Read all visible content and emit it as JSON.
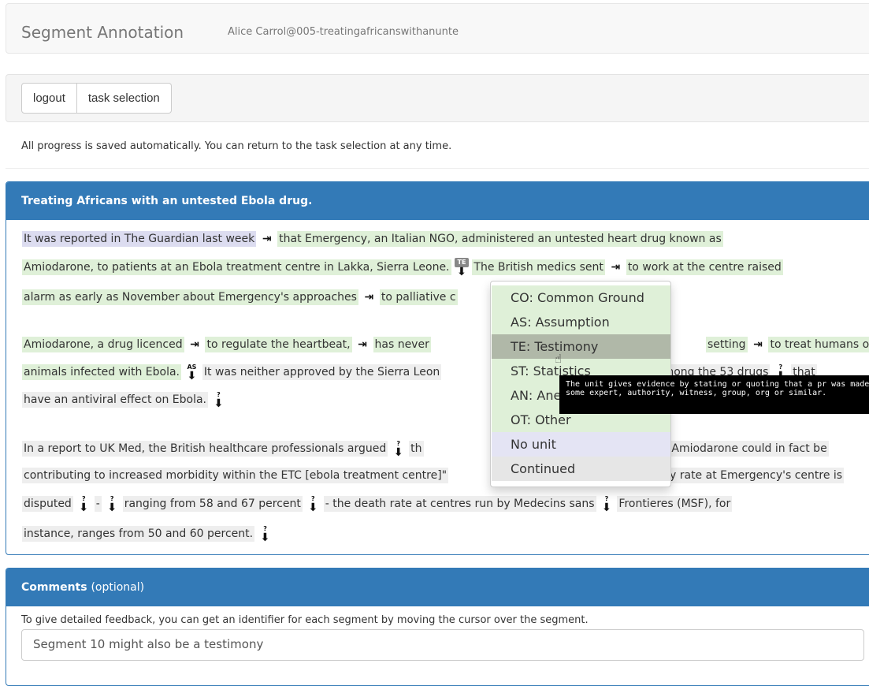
{
  "navbar": {
    "brand": "Segment Annotation",
    "user": "Alice Carrol@005-treatingafricanswithanunte"
  },
  "toolbar": {
    "logout_label": "logout",
    "task_selection_label": "task selection"
  },
  "info_text": "All progress is saved automatically. You can return to the task selection at any time.",
  "article": {
    "title": "Treating Africans with an untested Ebola drug.",
    "lines": [
      [
        {
          "text": "It was reported in The Guardian last week",
          "bg": "purple"
        },
        {
          "marker": "→",
          "tag": ""
        },
        {
          "text": "that Emergency, an Italian NGO, administered an untested heart drug known as",
          "bg": "green"
        }
      ],
      [
        {
          "text": "Amiodarone, to patients at an Ebola treatment centre in Lakka, Sierra Leone.",
          "bg": "green"
        },
        {
          "marker": "↓",
          "tag": "TE",
          "active": true
        },
        {
          "text": "The British medics sent",
          "bg": "green"
        },
        {
          "marker": "→",
          "tag": ""
        },
        {
          "text": "to work at the centre raised",
          "bg": "green"
        }
      ],
      [
        {
          "text": "alarm as early as November about Emergency's approaches",
          "bg": "green"
        },
        {
          "marker": "→",
          "tag": ""
        },
        {
          "text": "to palliative c",
          "bg": "green"
        }
      ],
      [
        {
          "text": "Amiodarone, a drug licenced",
          "bg": "green"
        },
        {
          "marker": "→",
          "tag": ""
        },
        {
          "text": "to regulate the heartbeat,",
          "bg": "green"
        },
        {
          "marker": "→",
          "tag": ""
        },
        {
          "text": "has never",
          "bg": "green"
        }
      ],
      [
        {
          "text": "animals infected with Ebola.",
          "bg": "green"
        },
        {
          "marker": "↓",
          "tag": "AS"
        },
        {
          "text": "It was neither approved by the Sierra Leon",
          "bg": "gray"
        }
      ],
      [
        {
          "text": "have an antiviral effect on Ebola.",
          "bg": "gray"
        },
        {
          "marker": "↓",
          "tag": "?"
        }
      ],
      [
        {
          "text": "In a report to UK Med, the British healthcare professionals argued",
          "bg": "gray"
        },
        {
          "marker": "↓",
          "tag": "?"
        },
        {
          "text": "th",
          "bg": "gray"
        }
      ],
      [
        {
          "text": "contributing to increased morbidity within the ETC [ebola treatment centre]\"",
          "bg": "gray"
        }
      ],
      [
        {
          "text": "disputed",
          "bg": "gray"
        },
        {
          "marker": "↓",
          "tag": "?"
        },
        {
          "text": "-",
          "bg": "gray"
        },
        {
          "marker": "↓",
          "tag": "?"
        },
        {
          "text": "ranging from 58 and 67 percent",
          "bg": "gray"
        },
        {
          "marker": "↓",
          "tag": "?"
        },
        {
          "text": "- the death rate at centres run by Medecins sans",
          "bg": "gray"
        },
        {
          "marker": "↓",
          "tag": "?"
        },
        {
          "text": "Frontieres (MSF), for",
          "bg": "gray"
        }
      ],
      [
        {
          "text": "instance, ranges from 50 and 60 percent.",
          "bg": "gray"
        },
        {
          "marker": "↓",
          "tag": "?"
        }
      ]
    ],
    "right_fragments": {
      "line4": [
        {
          "text": "setting",
          "bg": "green"
        },
        {
          "marker": "→",
          "tag": ""
        },
        {
          "text": "to treat humans or",
          "bg": "green"
        }
      ],
      "line5": [
        {
          "text": "among the 53 drugs",
          "bg": "gray"
        },
        {
          "marker": "↓",
          "tag": "?"
        },
        {
          "text": "that",
          "bg": "gray"
        }
      ],
      "line7": [
        {
          "text": "f Amiodarone could in fact be",
          "bg": "gray"
        }
      ],
      "line8": [
        {
          "text": "y rate at Emergency's centre is",
          "bg": "gray"
        }
      ]
    }
  },
  "dropdown": {
    "items": [
      {
        "label": "CO: Common Ground",
        "bg": "#dff0d8"
      },
      {
        "label": "AS: Assumption",
        "bg": "#dff0d8"
      },
      {
        "label": "TE: Testimony",
        "bg": "#b0b8a8",
        "hover": true
      },
      {
        "label": "ST: Statistics",
        "bg": "#dff0d8"
      },
      {
        "label": "AN: Anecdote",
        "bg": "#dff0d8"
      },
      {
        "label": "OT: Other",
        "bg": "#dff0d8"
      },
      {
        "label": "No unit",
        "bg": "#e4e4f4"
      },
      {
        "label": "Continued",
        "bg": "#e6e6e6"
      }
    ]
  },
  "tooltip": {
    "text": "The unit gives evidence by stating or quoting that a pr was made by some expert, authority, witness, group, org or similar."
  },
  "comments": {
    "title": "Comments",
    "optional": "(optional)",
    "help": "To give detailed feedback, you can get an identifier for each segment by moving the cursor over the segment.",
    "value": "Segment 10 might also be a testimony"
  },
  "colors": {
    "primary": "#337ab7",
    "segment_green": "#dff0d8",
    "segment_purple": "#dcdcf0",
    "segment_gray": "#eeeeee"
  }
}
